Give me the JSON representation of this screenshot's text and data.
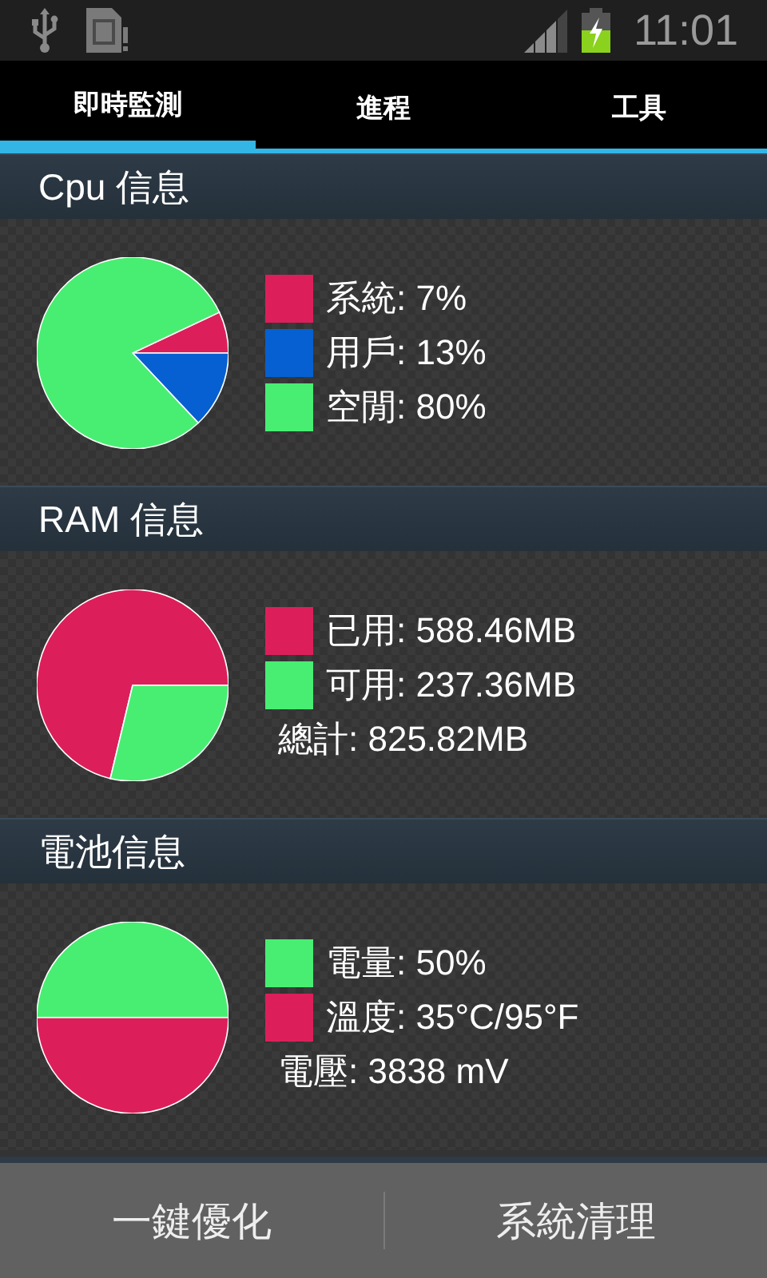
{
  "status_bar": {
    "time": "11:01",
    "battery_charging": true
  },
  "tabs": [
    {
      "label": "即時監測",
      "selected": true
    },
    {
      "label": "進程",
      "selected": false
    },
    {
      "label": "工具",
      "selected": false
    }
  ],
  "sections": [
    {
      "title": "Cpu 信息",
      "legend": [
        {
          "text": "系統: 7%",
          "color": "#dc1f5a"
        },
        {
          "text": "用戶: 13%",
          "color": "#0660d1"
        },
        {
          "text": "空閒: 80%",
          "color": "#48ee72"
        }
      ],
      "chart_data": {
        "type": "pie",
        "values": [
          7,
          13,
          80
        ]
      }
    },
    {
      "title": "RAM 信息",
      "legend": [
        {
          "text": "已用: 588.46MB",
          "color": "#dc1f5a"
        },
        {
          "text": "可用: 237.36MB",
          "color": "#48ee72"
        },
        {
          "text": "總計: 825.82MB"
        }
      ],
      "chart_data": {
        "type": "pie",
        "values": [
          71.26,
          28.74
        ]
      }
    },
    {
      "title": "電池信息",
      "legend": [
        {
          "text": "電量: 50%",
          "color": "#48ee72"
        },
        {
          "text": "溫度: 35°C/95°F",
          "color": "#dc1f5a"
        },
        {
          "text": "電壓: 3838 mV"
        }
      ],
      "chart_data": {
        "type": "pie",
        "values": [
          50,
          50
        ]
      }
    }
  ],
  "buttons": [
    "一鍵優化",
    "系統清理"
  ]
}
